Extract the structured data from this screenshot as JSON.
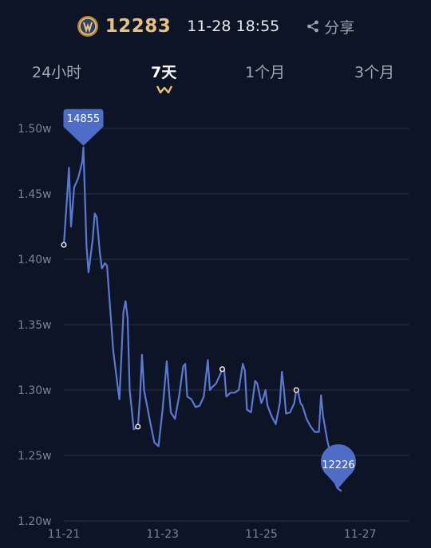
{
  "header": {
    "coin_value": "12283",
    "timestamp": "11-28 18:55",
    "share_label": "分享",
    "accent": "#e8c27a"
  },
  "tabs": [
    {
      "label": "24小时",
      "active": false
    },
    {
      "label": "7天",
      "active": true
    },
    {
      "label": "1个月",
      "active": false
    },
    {
      "label": "3个月",
      "active": false
    }
  ],
  "chart_data": {
    "type": "line",
    "ylim": [
      1.2,
      1.5
    ],
    "yticks": [
      "1.50w",
      "1.45w",
      "1.40w",
      "1.35w",
      "1.30w",
      "1.25w",
      "1.20w"
    ],
    "xticks": [
      "11-21",
      "11-23",
      "11-25",
      "11-27"
    ],
    "xlim": [
      "11-21",
      "11-28"
    ],
    "grid": true,
    "line_color": "#5a79d6",
    "max_label": "14855",
    "min_label": "12226",
    "series": [
      {
        "points": [
          [
            "11-21 00:00",
            1.411
          ],
          [
            "11-21 02:00",
            1.458
          ],
          [
            "11-21 02:30",
            1.47
          ],
          [
            "11-21 03:30",
            1.425
          ],
          [
            "11-21 05:00",
            1.455
          ],
          [
            "11-21 07:00",
            1.462
          ],
          [
            "11-21 09:00",
            1.475
          ],
          [
            "11-21 09:30",
            1.4855
          ],
          [
            "11-21 11:00",
            1.41
          ],
          [
            "11-21 12:00",
            1.39
          ],
          [
            "11-21 14:00",
            1.415
          ],
          [
            "11-21 15:00",
            1.435
          ],
          [
            "11-21 16:00",
            1.432
          ],
          [
            "11-21 17:30",
            1.405
          ],
          [
            "11-21 18:30",
            1.393
          ],
          [
            "11-21 20:00",
            1.397
          ],
          [
            "11-21 21:00",
            1.395
          ],
          [
            "11-22 00:00",
            1.33
          ],
          [
            "11-22 02:00",
            1.305
          ],
          [
            "11-22 03:00",
            1.293
          ],
          [
            "11-22 05:00",
            1.36
          ],
          [
            "11-22 06:00",
            1.368
          ],
          [
            "11-22 07:00",
            1.355
          ],
          [
            "11-22 08:00",
            1.3
          ],
          [
            "11-22 10:00",
            1.27
          ],
          [
            "11-22 12:00",
            1.272
          ],
          [
            "11-22 13:00",
            1.295
          ],
          [
            "11-22 14:00",
            1.327
          ],
          [
            "11-22 15:00",
            1.3
          ],
          [
            "11-22 18:00",
            1.275
          ],
          [
            "11-22 20:00",
            1.26
          ],
          [
            "11-22 22:00",
            1.257
          ],
          [
            "11-23 00:00",
            1.285
          ],
          [
            "11-23 02:00",
            1.322
          ],
          [
            "11-23 03:00",
            1.302
          ],
          [
            "11-23 04:00",
            1.283
          ],
          [
            "11-23 06:00",
            1.278
          ],
          [
            "11-23 08:00",
            1.295
          ],
          [
            "11-23 10:00",
            1.318
          ],
          [
            "11-23 11:00",
            1.32
          ],
          [
            "11-23 12:00",
            1.295
          ],
          [
            "11-23 14:00",
            1.293
          ],
          [
            "11-23 16:00",
            1.287
          ],
          [
            "11-23 18:00",
            1.288
          ],
          [
            "11-23 20:00",
            1.295
          ],
          [
            "11-23 22:00",
            1.323
          ],
          [
            "11-23 23:00",
            1.3
          ],
          [
            "11-24 00:00",
            1.302
          ],
          [
            "11-24 02:00",
            1.305
          ],
          [
            "11-24 04:00",
            1.312
          ],
          [
            "11-24 05:00",
            1.316
          ],
          [
            "11-24 06:00",
            1.315
          ],
          [
            "11-24 07:00",
            1.295
          ],
          [
            "11-24 09:00",
            1.298
          ],
          [
            "11-24 11:00",
            1.298
          ],
          [
            "11-24 13:00",
            1.3
          ],
          [
            "11-24 15:00",
            1.32
          ],
          [
            "11-24 16:00",
            1.315
          ],
          [
            "11-24 17:00",
            1.285
          ],
          [
            "11-24 19:00",
            1.283
          ],
          [
            "11-24 21:00",
            1.307
          ],
          [
            "11-24 22:00",
            1.305
          ],
          [
            "11-25 00:00",
            1.29
          ],
          [
            "11-25 01:00",
            1.294
          ],
          [
            "11-25 02:00",
            1.3
          ],
          [
            "11-25 03:00",
            1.288
          ],
          [
            "11-25 05:00",
            1.28
          ],
          [
            "11-25 07:00",
            1.274
          ],
          [
            "11-25 09:00",
            1.29
          ],
          [
            "11-25 10:00",
            1.314
          ],
          [
            "11-25 11:00",
            1.3
          ],
          [
            "11-25 12:00",
            1.282
          ],
          [
            "11-25 14:00",
            1.283
          ],
          [
            "11-25 16:00",
            1.29
          ],
          [
            "11-25 17:00",
            1.3
          ],
          [
            "11-25 18:00",
            1.298
          ],
          [
            "11-25 19:00",
            1.29
          ],
          [
            "11-25 20:00",
            1.288
          ],
          [
            "11-25 22:00",
            1.278
          ],
          [
            "11-26 00:00",
            1.272
          ],
          [
            "11-26 02:00",
            1.268
          ],
          [
            "11-26 04:00",
            1.268
          ],
          [
            "11-26 05:00",
            1.296
          ],
          [
            "11-26 06:00",
            1.28
          ],
          [
            "11-26 08:00",
            1.262
          ],
          [
            "11-26 09:00",
            1.255
          ],
          [
            "11-26 10:00",
            1.248
          ],
          [
            "11-26 11:00",
            1.232
          ],
          [
            "11-26 13:00",
            1.225
          ],
          [
            "11-26 15:00",
            1.2226
          ]
        ],
        "markers": [
          [
            "11-21 00:00",
            1.411
          ],
          [
            "11-22 12:00",
            1.272
          ],
          [
            "11-24 05:00",
            1.316
          ],
          [
            "11-25 17:00",
            1.3
          ]
        ]
      }
    ]
  }
}
